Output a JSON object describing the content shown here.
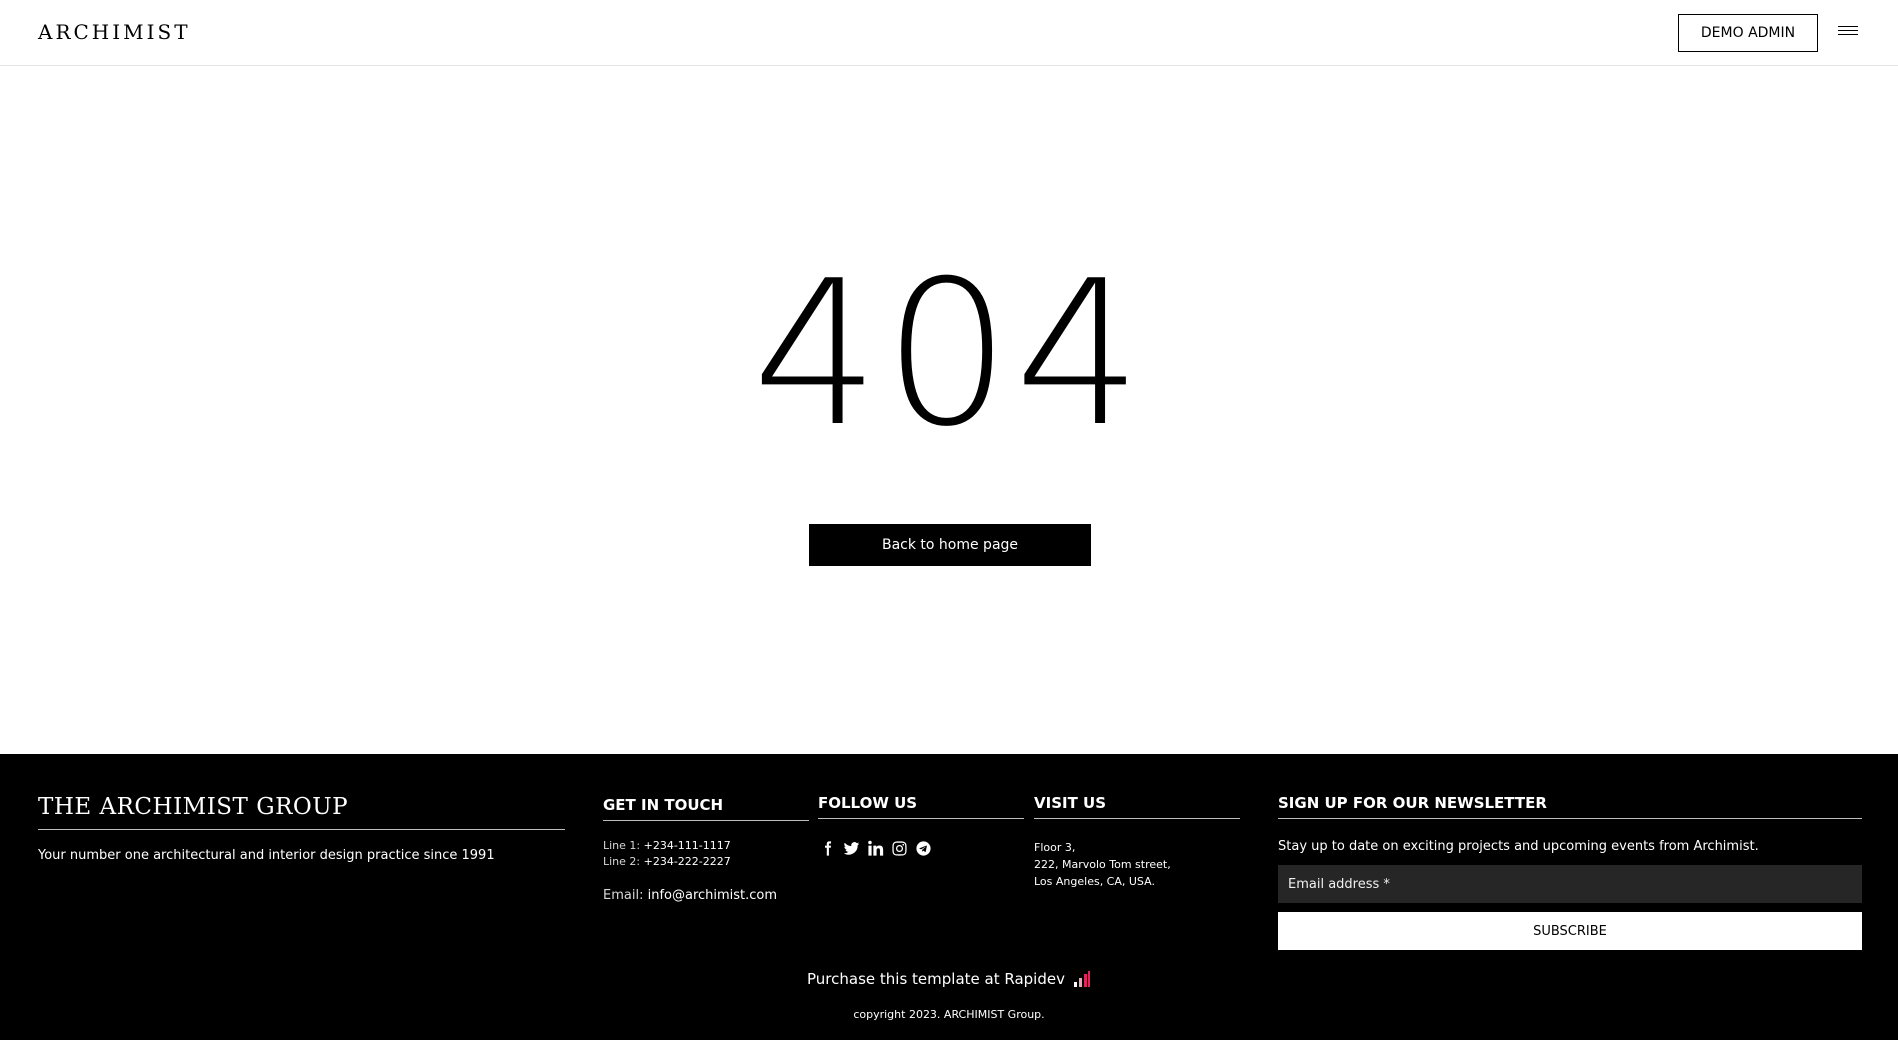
{
  "header": {
    "logo": "ARCHIMIST",
    "demo_button": "DEMO ADMIN",
    "menu_icon": "hamburger-icon"
  },
  "main": {
    "error_code": "404",
    "home_button": "Back to home page"
  },
  "footer": {
    "brand_title": "THE ARCHIMIST GROUP",
    "brand_tagline": "Your number one architectural and interior design practice since 1991",
    "get_in_touch": {
      "heading": "GET IN TOUCH",
      "line1_label": "Line 1:",
      "line1_value": "+234-111-1117",
      "line2_label": "Line 2:",
      "line2_value": "+234-222-2227",
      "email_label": "Email:",
      "email_value": "info@archimist.com"
    },
    "follow_us": {
      "heading": "FOLLOW US",
      "icons": [
        "facebook-icon",
        "twitter-icon",
        "linkedin-icon",
        "instagram-icon",
        "telegram-icon"
      ]
    },
    "visit_us": {
      "heading": "VISIT US",
      "address_line1": "Floor 3,",
      "address_line2": "222, Marvolo Tom street,",
      "address_line3": "Los Angeles, CA, USA."
    },
    "newsletter": {
      "heading": "SIGN UP FOR OUR NEWSLETTER",
      "text": "Stay up to date on exciting projects and upcoming events from Archimist.",
      "email_placeholder": "Email address *",
      "subscribe_button": "SUBSCRIBE"
    },
    "purchase_text": "Purchase this template at Rapidev",
    "copyright": "copyright 2023. ARCHIMIST Group."
  },
  "colors": {
    "background": "#ffffff",
    "footer_bg": "#000000",
    "input_bg": "#262626",
    "rapidev_accent": "#e0245e"
  }
}
